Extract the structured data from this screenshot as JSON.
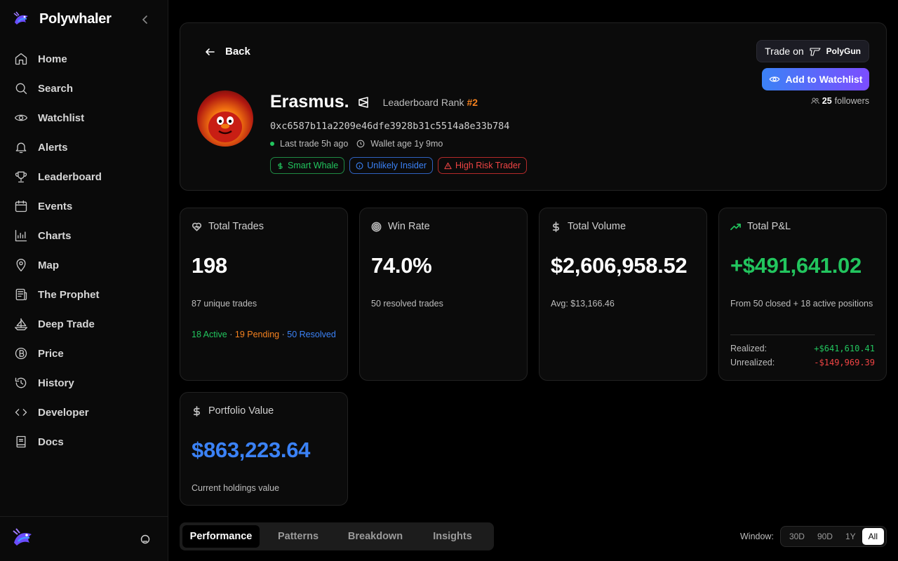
{
  "app": {
    "name": "Polywhaler"
  },
  "sidebar": {
    "items": [
      {
        "label": "Home",
        "icon": "home-icon"
      },
      {
        "label": "Search",
        "icon": "search-icon"
      },
      {
        "label": "Watchlist",
        "icon": "eye-icon"
      },
      {
        "label": "Alerts",
        "icon": "bell-icon"
      },
      {
        "label": "Leaderboard",
        "icon": "trophy-icon"
      },
      {
        "label": "Events",
        "icon": "calendar-icon"
      },
      {
        "label": "Charts",
        "icon": "chart-icon"
      },
      {
        "label": "Map",
        "icon": "map-pin-icon"
      },
      {
        "label": "The Prophet",
        "icon": "newspaper-icon"
      },
      {
        "label": "Deep Trade",
        "icon": "sailboat-icon"
      },
      {
        "label": "Price",
        "icon": "bitcoin-icon"
      },
      {
        "label": "History",
        "icon": "history-icon"
      },
      {
        "label": "Developer",
        "icon": "code-icon"
      },
      {
        "label": "Docs",
        "icon": "book-icon"
      }
    ]
  },
  "profile": {
    "back_label": "Back",
    "name": "Erasmus.",
    "rank_label": "Leaderboard Rank",
    "rank_value": "#2",
    "address": "0xc6587b11a2209e46dfe3928b31c5514a8e33b784",
    "last_trade": "Last trade 5h ago",
    "wallet_age": "Wallet age 1y 9mo",
    "tags": {
      "smart_whale": "Smart Whale",
      "unlikely_insider": "Unlikely Insider",
      "high_risk": "High Risk Trader"
    },
    "trade_on_label": "Trade on",
    "trade_on_brand": "PolyGun",
    "watchlist_label": "Add to Watchlist",
    "followers_count": "25",
    "followers_label": "followers"
  },
  "stats": {
    "total_trades": {
      "title": "Total Trades",
      "value": "198",
      "sub": "87 unique trades",
      "active": "18 Active",
      "pending": "19 Pending",
      "resolved": "50 Resolved",
      "sep": "·"
    },
    "win_rate": {
      "title": "Win Rate",
      "value": "74.0%",
      "sub": "50 resolved trades"
    },
    "total_volume": {
      "title": "Total Volume",
      "value": "$2,606,958.52",
      "sub": "Avg: $13,166.46"
    },
    "total_pnl": {
      "title": "Total P&L",
      "value": "+$491,641.02",
      "sub": "From 50 closed + 18 active positions",
      "realized_label": "Realized:",
      "realized_value": "+$641,610.41",
      "unrealized_label": "Unrealized:",
      "unrealized_value": "-$149,969.39"
    },
    "portfolio": {
      "title": "Portfolio Value",
      "value": "$863,223.64",
      "sub": "Current holdings value"
    }
  },
  "colors": {
    "positive": "#22c55e",
    "negative": "#ef4444",
    "accent_blue": "#3b82f6",
    "pending_orange": "#f5821f"
  },
  "tabs": [
    {
      "label": "Performance",
      "active": true
    },
    {
      "label": "Patterns"
    },
    {
      "label": "Breakdown"
    },
    {
      "label": "Insights"
    }
  ],
  "window": {
    "label": "Window:",
    "options": [
      "30D",
      "90D",
      "1Y",
      "All"
    ],
    "selected": "All"
  }
}
